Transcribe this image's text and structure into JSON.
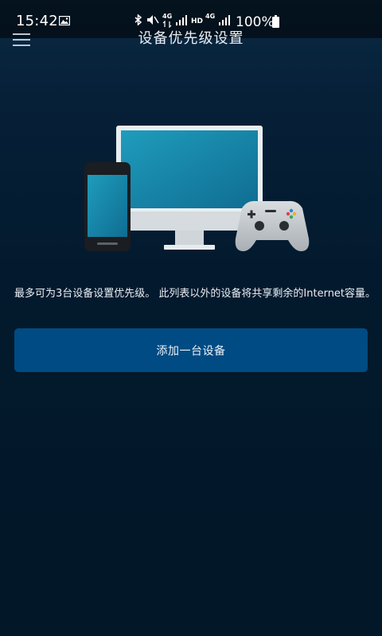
{
  "status_bar": {
    "time": "15:42",
    "battery_text": "100%",
    "icons": [
      "gallery-icon",
      "bluetooth-icon",
      "mute-icon",
      "4g-data-icon",
      "signal-icon",
      "hd-icon",
      "4g-icon",
      "signal-icon",
      "battery-icon"
    ],
    "labels": {
      "lte1": "4G",
      "hd": "HD",
      "lte2": "4G"
    }
  },
  "header": {
    "title": "设备优先级设置",
    "menu_icon": "hamburger-menu-icon"
  },
  "main": {
    "illustration_icons": [
      "smartphone-icon",
      "desktop-monitor-icon",
      "game-controller-icon"
    ],
    "description": "最多可为3台设备设置优先级。 此列表以外的设备将共享剩余的Internet容量。",
    "add_button_label": "添加一台设备"
  },
  "colors": {
    "background": "#031a2e",
    "button": "#004b83",
    "screen_teal": "#1a8fb0"
  }
}
